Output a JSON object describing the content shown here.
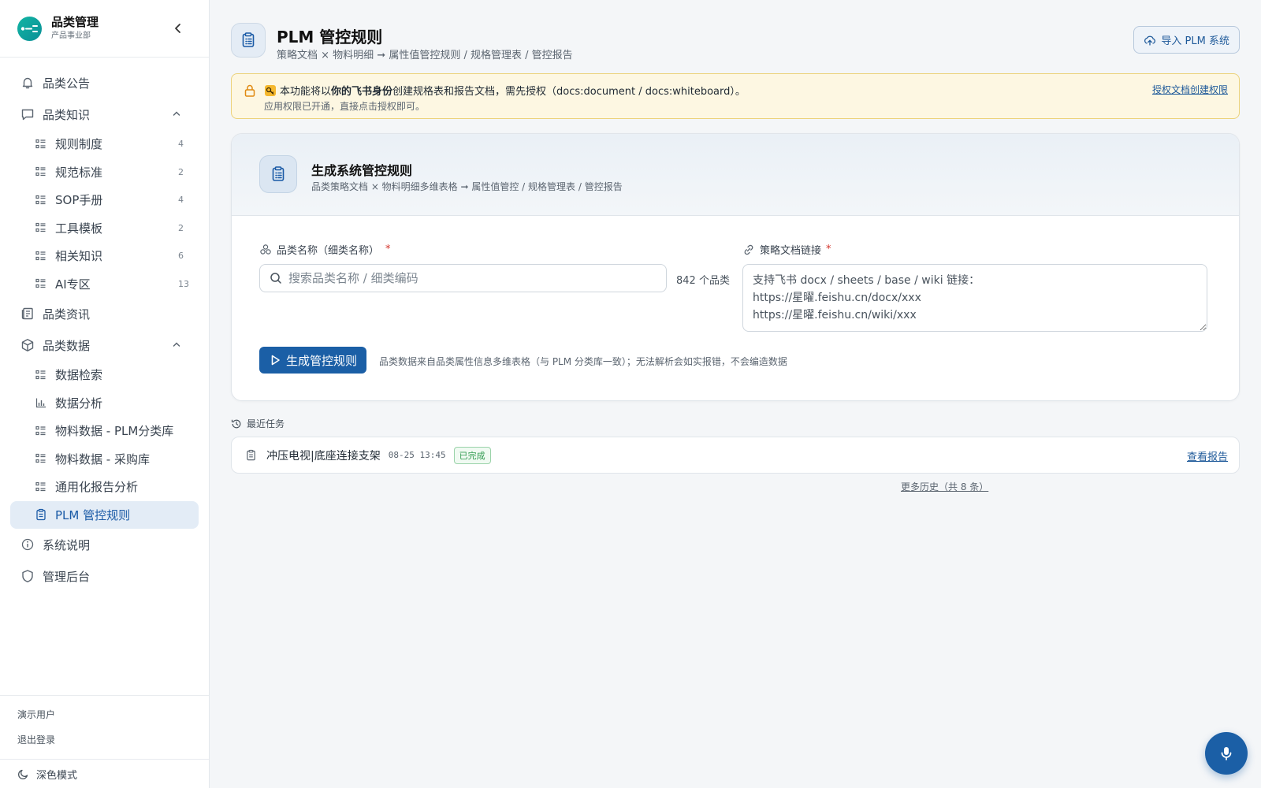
{
  "brand": {
    "title": "品类管理",
    "subtitle": "产品事业部"
  },
  "sidebar": {
    "items": [
      {
        "label": "品类公告",
        "icon": "bell-icon"
      },
      {
        "label": "品类知识",
        "icon": "chat-icon",
        "expanded": true,
        "children": [
          {
            "label": "规则制度",
            "count": "4"
          },
          {
            "label": "规范标准",
            "count": "2"
          },
          {
            "label": "SOP手册",
            "count": "4"
          },
          {
            "label": "工具模板",
            "count": "2"
          },
          {
            "label": "相关知识",
            "count": "6"
          },
          {
            "label": "AI专区",
            "count": "13"
          }
        ]
      },
      {
        "label": "品类资讯",
        "icon": "newspaper-icon"
      },
      {
        "label": "品类数据",
        "icon": "package-icon",
        "expanded": true,
        "children": [
          {
            "label": "数据检索"
          },
          {
            "label": "数据分析"
          },
          {
            "label": "物料数据 - PLM分类库"
          },
          {
            "label": "物料数据 - 采购库"
          },
          {
            "label": "通用化报告分析"
          },
          {
            "label": "PLM 管控规则",
            "active": true
          }
        ]
      },
      {
        "label": "系统说明",
        "icon": "info-icon"
      },
      {
        "label": "管理后台",
        "icon": "shield-icon"
      }
    ],
    "footer": {
      "user": "演示用户",
      "logout": "退出登录",
      "dark_mode": "深色模式"
    }
  },
  "header": {
    "title": "PLM 管控规则",
    "subtitle": "策略文档 × 物料明细 ➞ 属性值管控规则 / 规格管理表 / 管控报告",
    "import_button": "导入 PLM 系统"
  },
  "notice": {
    "prefix": "本功能将以",
    "bold": "你的飞书身份",
    "suffix": "创建规格表和报告文档，需先授权（docs:document / docs:whiteboard）。",
    "line2": "应用权限已开通，直接点击授权即可。",
    "link": "授权文档创建权限"
  },
  "card": {
    "title": "生成系统管控规则",
    "subtitle": "品类策略文档 × 物料明细多维表格 ➞ 属性值管控 / 规格管理表 / 管控报告",
    "category_label": "品类名称（细类名称）",
    "required_mark": "*",
    "search_placeholder": "搜索品类名称 / 细类编码",
    "category_count": "842 个品类",
    "doc_label": "策略文档链接",
    "doc_placeholder": "支持飞书 docx / sheets / base / wiki 链接：\nhttps://星曜.feishu.cn/docx/xxx\nhttps://星曜.feishu.cn/wiki/xxx",
    "generate_button": "生成管控规则",
    "generate_note": "品类数据来自品类属性信息多维表格（与 PLM 分类库一致）；无法解析会如实报错，不会编造数据"
  },
  "recent": {
    "label": "最近任务",
    "tasks": [
      {
        "name": "冲压电视|底座连接支架",
        "time": "08-25 13:45",
        "status": "已完成",
        "link": "查看报告"
      }
    ],
    "more": "更多历史（共 8 条）"
  },
  "colors": {
    "accent": "#1b5fa6",
    "brand": "#12b5a4",
    "success": "#2e9a4e",
    "warning_bg": "#fdf7e2",
    "required": "#d4332b"
  }
}
